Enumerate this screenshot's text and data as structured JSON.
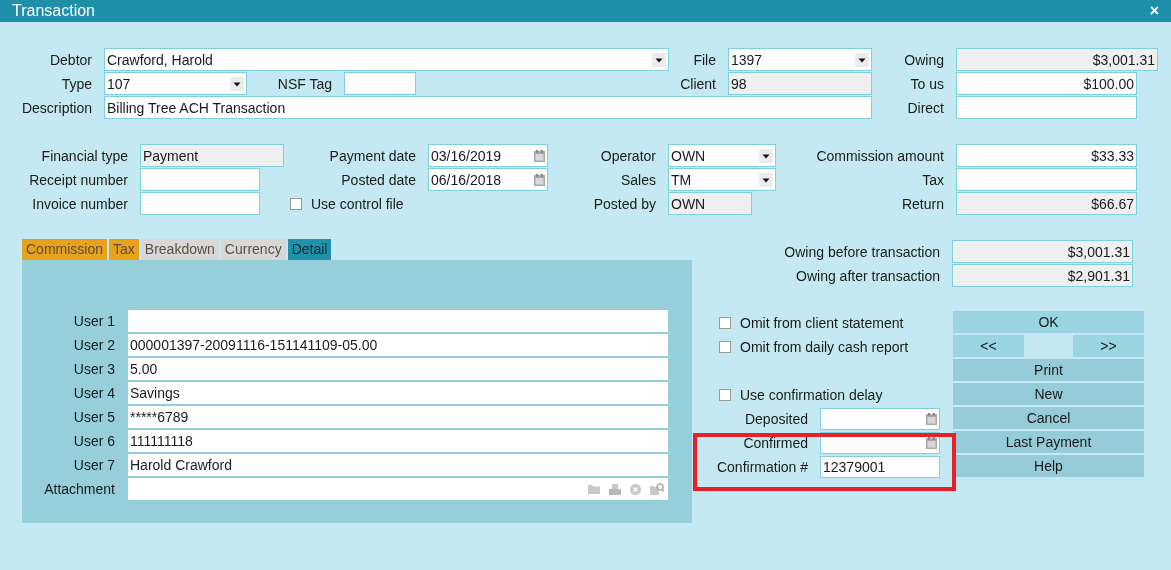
{
  "window": {
    "title": "Transaction",
    "close": "×"
  },
  "header": {
    "debtor": {
      "label": "Debtor",
      "value": "Crawford, Harold",
      "kind": "combo",
      "readonly": false
    },
    "file": {
      "label": "File",
      "value": "1397",
      "kind": "combo",
      "readonly": false
    },
    "owing": {
      "label": "Owing",
      "value": "$3,001.31",
      "kind": "amount",
      "readonly": true
    },
    "type": {
      "label": "Type",
      "value": "107",
      "kind": "combo",
      "readonly": false
    },
    "nsf_tag": {
      "label": "NSF Tag",
      "readonly": false
    },
    "client": {
      "label": "Client",
      "value": "98",
      "readonly": true
    },
    "to_us": {
      "label": "To us",
      "value": "$100.00",
      "kind": "amount",
      "readonly": false
    },
    "description": {
      "label": "Description",
      "value": "Billing Tree ACH Transaction",
      "readonly": false
    },
    "direct": {
      "label": "Direct",
      "readonly": false
    }
  },
  "financial": {
    "financial_type": {
      "label": "Financial type",
      "value": "Payment",
      "readonly": true
    },
    "payment_date": {
      "label": "Payment date",
      "value": "03/16/2019",
      "kind": "date",
      "readonly": false
    },
    "operator": {
      "label": "Operator",
      "value": "OWN",
      "kind": "combo",
      "readonly": false
    },
    "commission_amount": {
      "label": "Commission amount",
      "value": "$33.33",
      "kind": "amount",
      "readonly": false
    },
    "receipt_number": {
      "label": "Receipt number",
      "readonly": false
    },
    "posted_date": {
      "label": "Posted date",
      "value": "06/16/2018",
      "kind": "date",
      "readonly": false
    },
    "sales": {
      "label": "Sales",
      "value": "TM",
      "kind": "combo",
      "readonly": false
    },
    "tax": {
      "label": "Tax",
      "readonly": false
    },
    "invoice_number": {
      "label": "Invoice number",
      "readonly": false
    },
    "use_control_file": {
      "label": "Use control file",
      "checked": false
    },
    "posted_by": {
      "label": "Posted by",
      "value": "OWN",
      "readonly": true
    },
    "return": {
      "label": "Return",
      "value": "$66.67",
      "kind": "amount",
      "readonly": true
    }
  },
  "tabs": [
    {
      "label": "Commission",
      "selected": false,
      "color": "#e8a21c"
    },
    {
      "label": "Tax",
      "selected": false,
      "color": "#e8a21c"
    },
    {
      "label": "Breakdown",
      "selected": false,
      "color": "#d8d8d8"
    },
    {
      "label": "Currency",
      "selected": false,
      "color": "#d8d8d8"
    },
    {
      "label": "Detail",
      "selected": true,
      "color": "#1f91a9"
    }
  ],
  "user_fields": [
    {
      "label": "User 1"
    },
    {
      "label": "User 2",
      "value": "000001397-20091116-151141109-05.00"
    },
    {
      "label": "User 3",
      "value": "5.00"
    },
    {
      "label": "User 4",
      "value": "Savings"
    },
    {
      "label": "User 5",
      "value": "*****6789"
    },
    {
      "label": "User 6",
      "value": "111111118"
    },
    {
      "label": "User 7",
      "value": "Harold Crawford"
    }
  ],
  "attachment": {
    "label": "Attachment"
  },
  "totals": [
    {
      "label": "Owing before transaction",
      "value": "$3,001.31",
      "kind": "amount",
      "readonly": true
    },
    {
      "label": "Owing after transaction",
      "value": "$2,901.31",
      "kind": "amount",
      "readonly": true
    }
  ],
  "options": [
    {
      "label": "Omit from client statement",
      "checked": false
    },
    {
      "label": "Omit from daily cash report",
      "checked": false
    }
  ],
  "confirmation_delay": {
    "label": "Use confirmation delay",
    "checked": false
  },
  "deposited": {
    "label": "Deposited",
    "kind": "date",
    "readonly": false
  },
  "confirmed": {
    "label": "Confirmed",
    "kind": "date",
    "readonly": false
  },
  "confirmation_number": {
    "label": "Confirmation #",
    "value": "12379001",
    "readonly": false,
    "highlighted": true
  },
  "buttons": [
    {
      "label": "OK"
    },
    {
      "label": "<<"
    },
    {
      "label": ">>"
    },
    {
      "label": "Print"
    },
    {
      "label": "New"
    },
    {
      "label": "Cancel"
    },
    {
      "label": "Last Payment"
    },
    {
      "label": "Help"
    }
  ]
}
